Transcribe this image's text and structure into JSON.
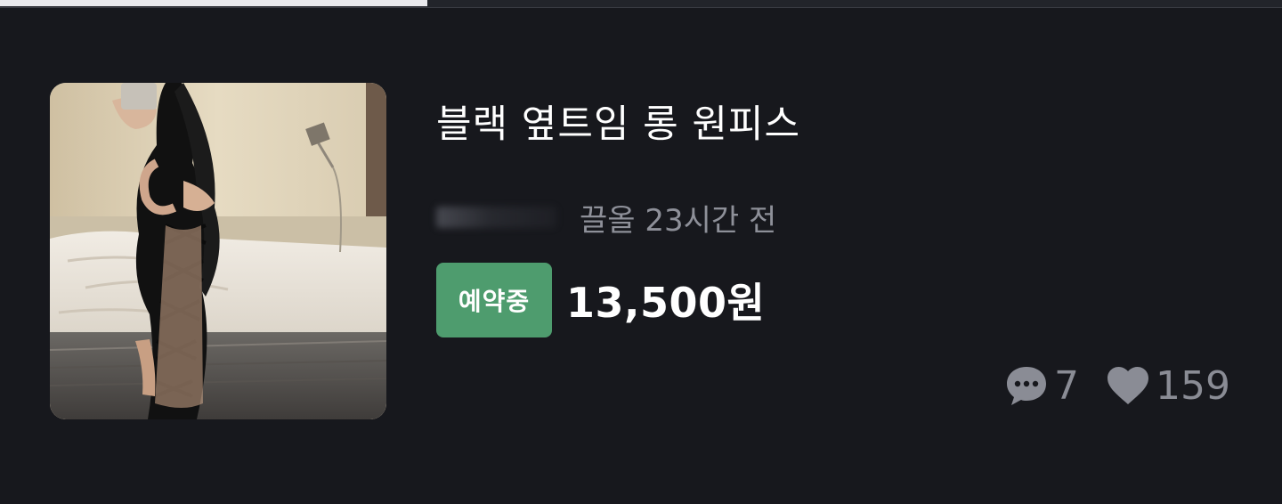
{
  "progress": {
    "fraction": 0.333
  },
  "listing": {
    "image_alt": "product-photo",
    "title": "블랙 옆트임 롱 원피스",
    "bump_time": "끌올 23시간 전",
    "status_badge": "예약중",
    "price": "13,500원",
    "comment_count": "7",
    "like_count": "159",
    "colors": {
      "background": "#17181d",
      "badge": "#4e9c6e",
      "meta_text": "#8e9099",
      "stat_text": "#8a8c95"
    },
    "icons": {
      "comments": "speech-bubble-icon",
      "likes": "heart-icon"
    }
  }
}
